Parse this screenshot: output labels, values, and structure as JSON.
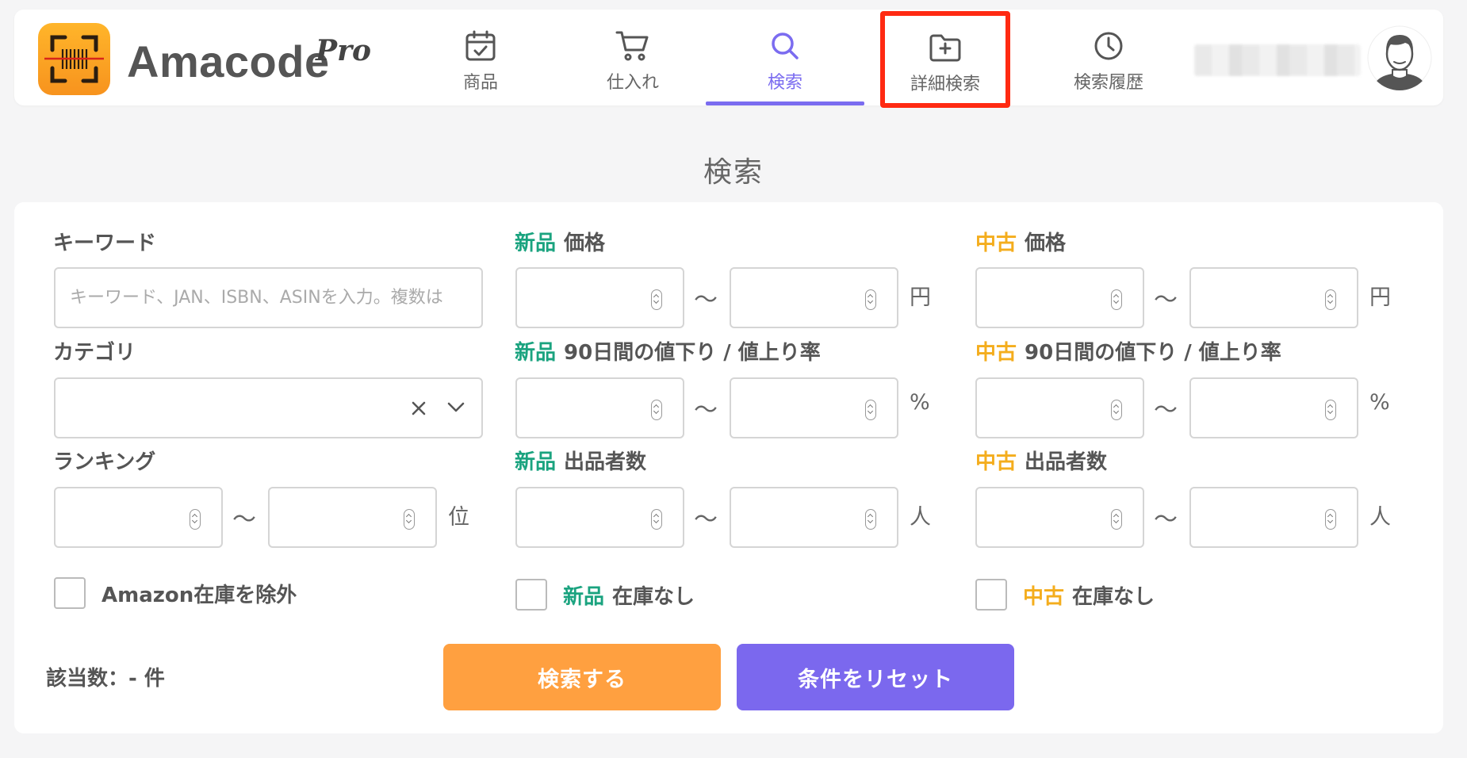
{
  "header": {
    "brand": "Amacode",
    "brand_suffix": "Pro",
    "nav": [
      {
        "label": "商品",
        "icon": "calendar-check-icon"
      },
      {
        "label": "仕入れ",
        "icon": "cart-icon"
      },
      {
        "label": "検索",
        "icon": "search-icon",
        "active": true
      },
      {
        "label": "詳細検索",
        "icon": "folder-plus-icon",
        "highlighted": true
      },
      {
        "label": "検索履歴",
        "icon": "clock-icon"
      }
    ]
  },
  "page_title": "検索",
  "form": {
    "keyword": {
      "label": "キーワード",
      "placeholder": "キーワード、JAN、ISBN、ASINを入力。複数は"
    },
    "category": {
      "label": "カテゴリ",
      "value": ""
    },
    "ranking": {
      "label": "ランキング",
      "unit": "位"
    },
    "tag_new": "新品",
    "tag_used": "中古",
    "price_label": "価格",
    "price_unit": "円",
    "rate_label": "90日間の値下り / 値上り率",
    "rate_unit": "%",
    "sellers_label": "出品者数",
    "sellers_unit": "人",
    "tilde": "〜",
    "exclude_amazon": "Amazon在庫を除外",
    "no_stock": "在庫なし"
  },
  "footer": {
    "result_count": "該当数：- 件",
    "search_button": "検索する",
    "reset_button": "条件をリセット"
  },
  "colors": {
    "accent": "#7b6cf0",
    "new": "#1aa37f",
    "used": "#f4ad1d",
    "search_button": "#ffa040",
    "reset_button": "#7b68ee",
    "highlight_box": "#ff2a12"
  }
}
